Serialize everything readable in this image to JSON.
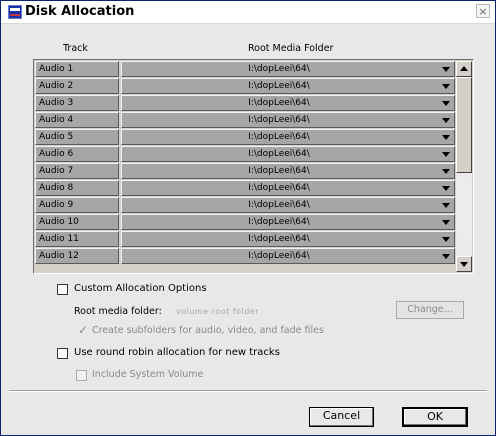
{
  "window": {
    "title": "Disk Allocation",
    "close_label": "×"
  },
  "table": {
    "headers": {
      "track": "Track",
      "folder": "Root Media Folder"
    },
    "rows": [
      {
        "track": "Audio 1",
        "folder": "I:\\dopLeei\\64\\"
      },
      {
        "track": "Audio 2",
        "folder": "I:\\dopLeei\\64\\"
      },
      {
        "track": "Audio 3",
        "folder": "I:\\dopLeei\\64\\"
      },
      {
        "track": "Audio 4",
        "folder": "I:\\dopLeei\\64\\"
      },
      {
        "track": "Audio 5",
        "folder": "I:\\dopLeei\\64\\"
      },
      {
        "track": "Audio 6",
        "folder": "I:\\dopLeei\\64\\"
      },
      {
        "track": "Audio 7",
        "folder": "I:\\dopLeei\\64\\"
      },
      {
        "track": "Audio 8",
        "folder": "I:\\dopLeei\\64\\"
      },
      {
        "track": "Audio 9",
        "folder": "I:\\dopLeei\\64\\"
      },
      {
        "track": "Audio 10",
        "folder": "I:\\dopLeei\\64\\"
      },
      {
        "track": "Audio 11",
        "folder": "I:\\dopLeei\\64\\"
      },
      {
        "track": "Audio 12",
        "folder": "I:\\dopLeei\\64\\"
      }
    ]
  },
  "options": {
    "custom_allocation": {
      "label": "Custom Allocation Options",
      "checked": false
    },
    "root_media_label": "Root media folder:",
    "root_media_value": "volume   root folder",
    "change_label": "Change...",
    "create_subfolders": {
      "label": "Create subfolders for audio, video, and fade files",
      "checked": true,
      "enabled": false
    },
    "round_robin": {
      "label": "Use round robin allocation for new tracks",
      "checked": false
    },
    "include_system_volume": {
      "label": "Include System Volume",
      "checked": false,
      "enabled": false
    }
  },
  "buttons": {
    "cancel": "Cancel",
    "ok": "OK"
  }
}
